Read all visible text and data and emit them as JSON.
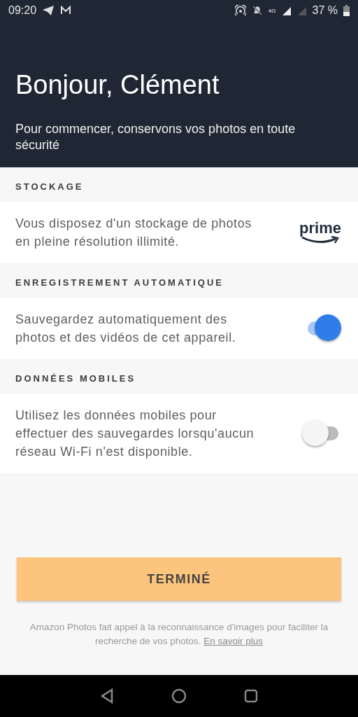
{
  "status_bar": {
    "time": "09:20",
    "network": "4G",
    "battery": "37 %"
  },
  "header": {
    "title": "Bonjour, Clément",
    "subtitle": "Pour commencer, conservons vos photos en toute sécurité"
  },
  "sections": [
    {
      "label": "STOCKAGE",
      "text": "Vous disposez d'un stockage de photos en pleine résolution illimité.",
      "kind": "logo",
      "logo": "prime"
    },
    {
      "label": "ENREGISTREMENT AUTOMATIQUE",
      "text": "Sauvegardez automatiquement des photos et des vidéos de cet appareil.",
      "kind": "toggle",
      "on": true
    },
    {
      "label": "DONNÉES MOBILES",
      "text": "Utilisez les données mobiles pour effectuer des sauvegardes lorsqu'aucun réseau Wi-Fi n'est disponible.",
      "kind": "toggle",
      "on": false
    }
  ],
  "done_button": "TERMINÉ",
  "footer": {
    "text": "Amazon Photos fait appel à la reconnaissance d'images pour faciliter la recherche de vos photos.",
    "link": "En savoir plus"
  }
}
